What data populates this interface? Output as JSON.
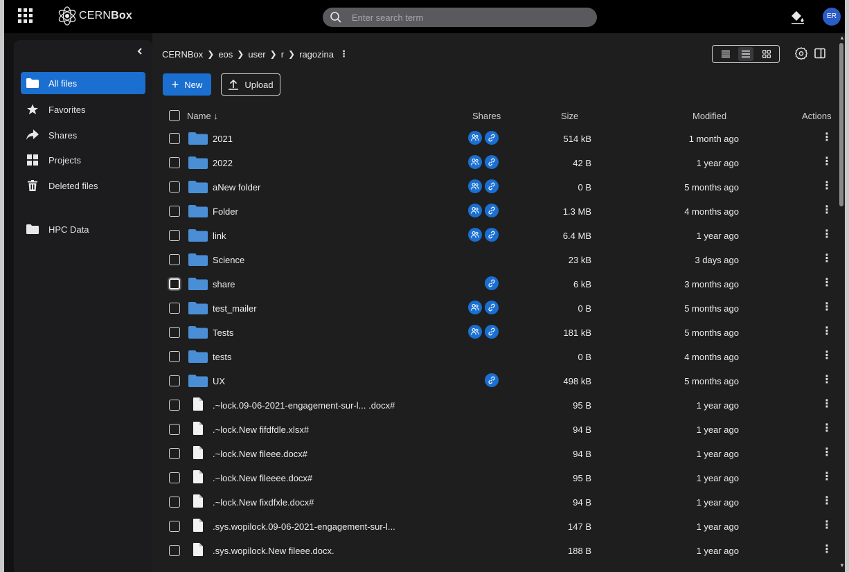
{
  "header": {
    "brand_pre": "CERN",
    "brand_bold": "Box",
    "search_placeholder": "Enter search term",
    "avatar_initials": "ER"
  },
  "sidebar": {
    "items": [
      {
        "label": "All files",
        "icon": "folder-icon",
        "active": true
      },
      {
        "label": "Favorites",
        "icon": "star-icon",
        "active": false
      },
      {
        "label": "Shares",
        "icon": "share-arrow-icon",
        "active": false
      },
      {
        "label": "Projects",
        "icon": "grid-icon",
        "active": false
      },
      {
        "label": "Deleted files",
        "icon": "trash-icon",
        "active": false
      },
      {
        "label": "HPC Data",
        "icon": "folder-icon",
        "active": false
      }
    ]
  },
  "breadcrumb": [
    "CERNBox",
    "eos",
    "user",
    "r",
    "ragozina"
  ],
  "toolbar": {
    "new_label": "New",
    "upload_label": "Upload"
  },
  "table": {
    "headers": {
      "name": "Name",
      "shares": "Shares",
      "size": "Size",
      "modified": "Modified",
      "actions": "Actions"
    },
    "rows": [
      {
        "name": "2021",
        "type": "folder",
        "shares": [
          "people",
          "link"
        ],
        "size": "514 kB",
        "modified": "1 month ago"
      },
      {
        "name": "2022",
        "type": "folder",
        "shares": [
          "people",
          "link"
        ],
        "size": "42 B",
        "modified": "1 year ago"
      },
      {
        "name": "aNew folder",
        "type": "folder",
        "shares": [
          "people",
          "link"
        ],
        "size": "0 B",
        "modified": "5 months ago"
      },
      {
        "name": "Folder",
        "type": "folder",
        "shares": [
          "people",
          "link"
        ],
        "size": "1.3 MB",
        "modified": "4 months ago"
      },
      {
        "name": "link",
        "type": "folder",
        "shares": [
          "people",
          "link"
        ],
        "size": "6.4 MB",
        "modified": "1 year ago"
      },
      {
        "name": "Science",
        "type": "folder",
        "shares": [],
        "size": "23 kB",
        "modified": "3 days ago"
      },
      {
        "name": "share",
        "type": "folder",
        "shares": [
          "link"
        ],
        "size": "6 kB",
        "modified": "3 months ago",
        "focus": true
      },
      {
        "name": "test_mailer",
        "type": "folder",
        "shares": [
          "people",
          "link"
        ],
        "size": "0 B",
        "modified": "5 months ago"
      },
      {
        "name": "Tests",
        "type": "folder",
        "shares": [
          "people",
          "link"
        ],
        "size": "181 kB",
        "modified": "5 months ago"
      },
      {
        "name": "tests",
        "type": "folder",
        "shares": [],
        "size": "0 B",
        "modified": "4 months ago"
      },
      {
        "name": "UX",
        "type": "folder",
        "shares": [
          "link"
        ],
        "size": "498 kB",
        "modified": "5 months ago"
      },
      {
        "name": ".~lock.09-06-2021-engagement-sur-l... .docx#",
        "type": "file",
        "shares": [],
        "size": "95 B",
        "modified": "1 year ago"
      },
      {
        "name": ".~lock.New fifdfdle.xlsx#",
        "type": "file",
        "shares": [],
        "size": "94 B",
        "modified": "1 year ago"
      },
      {
        "name": ".~lock.New fileee.docx#",
        "type": "file",
        "shares": [],
        "size": "94 B",
        "modified": "1 year ago"
      },
      {
        "name": ".~lock.New fileeee.docx#",
        "type": "file",
        "shares": [],
        "size": "95 B",
        "modified": "1 year ago"
      },
      {
        "name": ".~lock.New fixdfxle.docx#",
        "type": "file",
        "shares": [],
        "size": "94 B",
        "modified": "1 year ago"
      },
      {
        "name": ".sys.wopilock.09-06-2021-engagement-sur-l...",
        "type": "file",
        "shares": [],
        "size": "147 B",
        "modified": "1 year ago"
      },
      {
        "name": ".sys.wopilock.New fileee.docx.",
        "type": "file",
        "shares": [],
        "size": "188 B",
        "modified": "1 year ago"
      }
    ]
  },
  "colors": {
    "accent": "#1a6fd1",
    "folder": "#4a8fd6",
    "background": "#1e1e1e"
  }
}
